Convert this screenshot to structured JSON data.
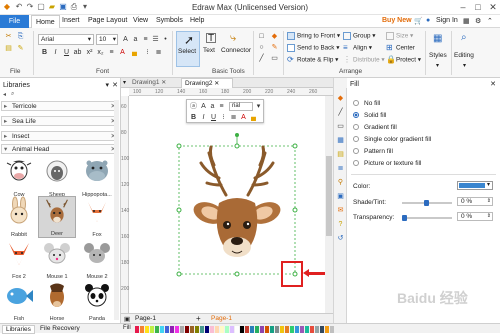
{
  "app": {
    "title": "Edraw Max (Unlicensed Version)"
  },
  "menu": [
    "File",
    "Home",
    "Insert",
    "Page Layout",
    "View",
    "Symbols",
    "Help"
  ],
  "menu_right": {
    "buy": "Buy New",
    "signin": "Sign In"
  },
  "ribbon": {
    "font_name": "Arial",
    "font_size": "10",
    "tools": {
      "select": "Select",
      "text": "Text",
      "connector": "Connector"
    },
    "arrange": {
      "bring": "Bring to Front",
      "send": "Send to Back",
      "rotate": "Rotate & Flip",
      "group": "Group",
      "align": "Align",
      "distribute": "Distribute",
      "size": "Size",
      "center": "Center",
      "protect": "Protect"
    },
    "styles": "Styles",
    "editing": "Editing",
    "groups": {
      "file": "File",
      "font": "Font",
      "basic_tools": "Basic Tools",
      "arrange": "Arrange"
    }
  },
  "libraries": {
    "title": "Libraries",
    "categories": [
      "Terricole",
      "Sea Life",
      "Insect",
      "Animal Head"
    ],
    "shapes": [
      "Cow",
      "Sheep",
      "Hippopota...",
      "Rabbit",
      "Deer",
      "Fox",
      "Fox 2",
      "Mouse 1",
      "Mouse 2",
      "Fish",
      "Horse",
      "Panda"
    ]
  },
  "tabs": {
    "drawing1": "Drawing1",
    "drawing2": "Drawing2"
  },
  "ruler": {
    "h": [
      "100",
      "120",
      "140",
      "160",
      "180",
      "200",
      "220",
      "240",
      "260"
    ],
    "v": [
      "60",
      "80",
      "100",
      "120",
      "140",
      "160",
      "180",
      "200"
    ]
  },
  "floating_toolbar": {
    "font": "rial"
  },
  "fill_panel": {
    "title": "Fill",
    "options": [
      "No fill",
      "Solid fill",
      "Gradient fill",
      "Single color gradient fill",
      "Pattern fill",
      "Picture or texture fill"
    ],
    "selected": "Solid fill",
    "color_label": "Color:",
    "color_value": "#3b86cf",
    "shade_label": "Shade/Tint:",
    "shade_value": "0 %",
    "transparency_label": "Transparency:",
    "transparency_value": "0 %"
  },
  "bottom": {
    "libraries_tab": "Libraries",
    "file_recovery_tab": "File Recovery",
    "page_tab": "Page-1",
    "page_tab_active": "Page-1"
  },
  "watermark": "Baidu 经验"
}
